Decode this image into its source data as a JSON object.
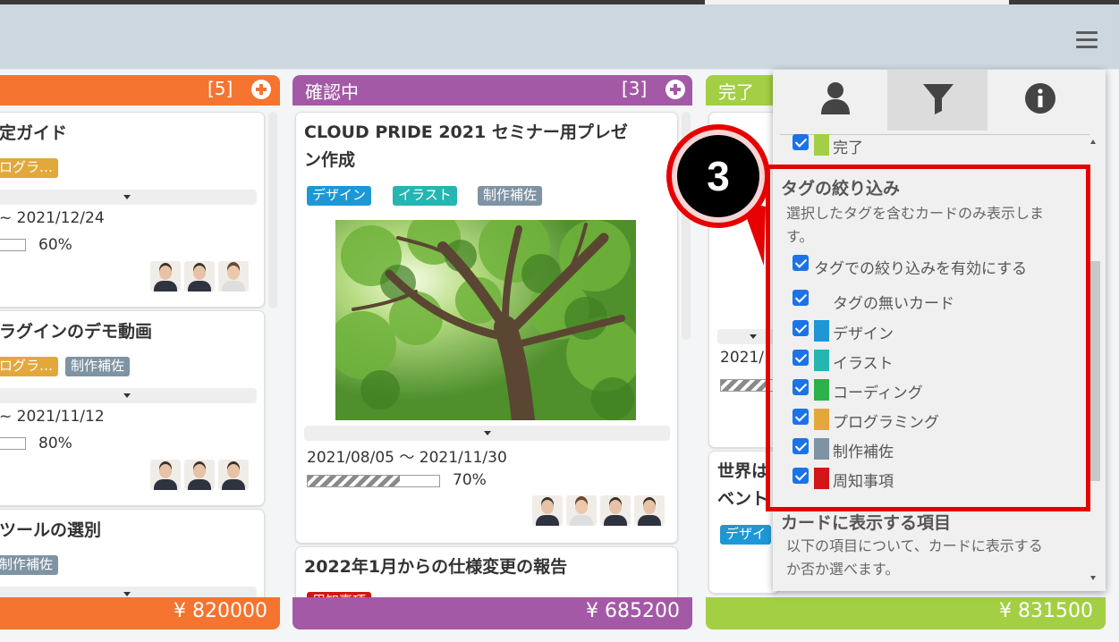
{
  "colors": {
    "orange": "#f47430",
    "purple": "#a459a6",
    "green": "#a3cf45",
    "accent_red": "#e60000",
    "checkbox_blue": "#1b73e8"
  },
  "header": {
    "menu_icon": "hamburger-icon"
  },
  "columns": [
    {
      "id": "orange",
      "title": "",
      "count": "[5]",
      "total": "¥ 820000",
      "cards": [
        {
          "title": "定ガイド",
          "tags": [
            {
              "label": "ログラ…",
              "color": "#e3a83c"
            }
          ],
          "date": "~ 2021/12/24",
          "progress": 60,
          "progress_label": "60%"
        },
        {
          "title": "ラグインのデモ動画",
          "tags": [
            {
              "label": "ログラ…",
              "color": "#e3a83c"
            },
            {
              "label": "制作補佐",
              "color": "#7e93a3"
            }
          ],
          "date": "~ 2021/11/12",
          "progress": 80,
          "progress_label": "80%"
        },
        {
          "title": "ツールの選別",
          "tags": [
            {
              "label": "制作補佐",
              "color": "#7e93a3"
            }
          ]
        }
      ]
    },
    {
      "id": "purple",
      "title": "確認中",
      "count": "[3]",
      "total": "¥ 685200",
      "cards": [
        {
          "title_line1": "CLOUD PRIDE 2021 セミナー用プレゼ",
          "title_line2": "ン作成",
          "tags": [
            {
              "label": "デザイン",
              "color": "#1f97d6"
            },
            {
              "label": "イラスト",
              "color": "#26b5b1"
            },
            {
              "label": "制作補佐",
              "color": "#7e93a3"
            }
          ],
          "date": "2021/08/05 ～ 2021/11/30",
          "progress": 70,
          "progress_label": "70%"
        },
        {
          "title": "2022年1月からの仕様変更の報告",
          "tags": [
            {
              "label": "周知事項",
              "color": "#d01616"
            }
          ]
        }
      ]
    },
    {
      "id": "green",
      "title": "完了",
      "total": "¥ 831500",
      "cards": [
        {
          "date": "2021/"
        },
        {
          "title_line1": "世界は",
          "title_line2": "ベント",
          "tags": [
            {
              "label": "デザイ",
              "color": "#1f97d6"
            }
          ]
        }
      ]
    }
  ],
  "panel": {
    "tabs": [
      {
        "name": "user",
        "icon": "user-icon"
      },
      {
        "name": "filter",
        "icon": "filter-icon"
      },
      {
        "name": "info",
        "icon": "info-icon"
      }
    ],
    "status_item": {
      "label": "完了",
      "color": "#a3cf45"
    },
    "tag_filter": {
      "title": "タグの絞り込み",
      "desc_line1": "選択したタグを含むカードのみ表示しま",
      "desc_line2": "す。",
      "enable_label": "タグでの絞り込みを有効にする",
      "no_tag_label": "タグの無いカード",
      "tags": [
        {
          "label": "デザイン",
          "color": "#1f97d6"
        },
        {
          "label": "イラスト",
          "color": "#26b5b1"
        },
        {
          "label": "コーディング",
          "color": "#2db14b"
        },
        {
          "label": "プログラミング",
          "color": "#e3a83c"
        },
        {
          "label": "制作補佐",
          "color": "#7e93a3"
        },
        {
          "label": "周知事項",
          "color": "#d01616"
        }
      ]
    },
    "card_items": {
      "title": "カードに表示する項目",
      "desc_line1": "以下の項目について、カードに表示する",
      "desc_line2": "か否か選べます。"
    }
  },
  "callout": {
    "number": "3"
  }
}
